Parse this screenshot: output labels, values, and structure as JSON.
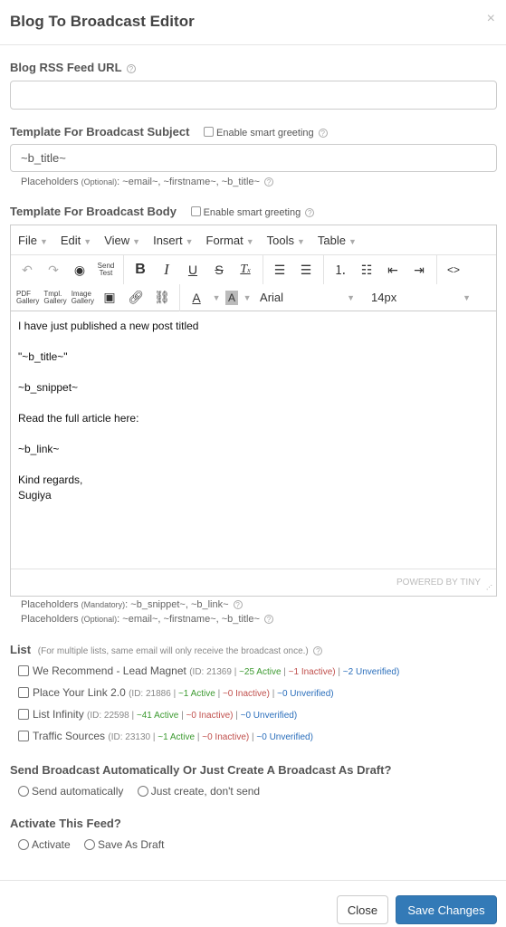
{
  "modal": {
    "title": "Blog To Broadcast Editor",
    "close_icon": "×"
  },
  "rss": {
    "label": "Blog RSS Feed URL",
    "value": "",
    "placeholder": ""
  },
  "subject": {
    "label": "Template For Broadcast Subject",
    "smart_greeting_label": "Enable smart greeting",
    "value": "~b_title~",
    "hint_prefix": "Placeholders",
    "hint_tag": "(Optional)",
    "hint_text": ": ~email~, ~firstname~, ~b_title~"
  },
  "body": {
    "label": "Template For Broadcast Body",
    "smart_greeting_label": "Enable smart greeting",
    "menu": [
      "File",
      "Edit",
      "View",
      "Insert",
      "Format",
      "Tools",
      "Table"
    ],
    "toolbar": {
      "send_test": [
        "Send",
        "Test"
      ],
      "pdf_gallery": [
        "PDF",
        "Gallery"
      ],
      "tmpl_gallery": [
        "Tmpl.",
        "Gallery"
      ],
      "image_gallery": [
        "Image",
        "Gallery"
      ],
      "font_family": "Arial",
      "font_size": "14px"
    },
    "content": [
      "I have just published a new post titled",
      "\"~b_title~\"",
      "~b_snippet~",
      "Read the full article here:",
      "~b_link~",
      "Kind regards,",
      "Sugiya"
    ],
    "powered_by": "POWERED BY TINY",
    "hint_mandatory_prefix": "Placeholders",
    "hint_mandatory_tag": "(Mandatory)",
    "hint_mandatory_text": ": ~b_snippet~, ~b_link~",
    "hint_optional_prefix": "Placeholders",
    "hint_optional_tag": "(Optional)",
    "hint_optional_text": ": ~email~, ~firstname~, ~b_title~"
  },
  "list": {
    "label": "List",
    "note": "(For multiple lists, same email will only receive the broadcast once.)",
    "items": [
      {
        "name": "We Recommend - Lead Magnet",
        "id": "(ID: 21369 | ",
        "active": "~25 Active",
        "inactive": "~1 Inactive)",
        "unverified": "~2 Unverified)"
      },
      {
        "name": "Place Your Link 2.0",
        "id": "(ID: 21886 | ",
        "active": "~1 Active",
        "inactive": "~0 Inactive)",
        "unverified": "~0 Unverified)"
      },
      {
        "name": "List Infinity",
        "id": "(ID: 22598 | ",
        "active": "~41 Active",
        "inactive": "~0 Inactive)",
        "unverified": "~0 Unverified)"
      },
      {
        "name": "Traffic Sources",
        "id": "(ID: 23130 | ",
        "active": "~1 Active",
        "inactive": "~0 Inactive)",
        "unverified": "~0 Unverified)"
      }
    ]
  },
  "send_mode": {
    "label": "Send Broadcast Automatically Or Just Create A Broadcast As Draft?",
    "options": [
      "Send automatically",
      "Just create, don't send"
    ]
  },
  "activate": {
    "label": "Activate This Feed?",
    "options": [
      "Activate",
      "Save As Draft"
    ]
  },
  "footer": {
    "close_label": "Close",
    "save_label": "Save Changes"
  },
  "colors": {
    "primary": "#337ab7",
    "active": "#3c9a30",
    "inactive": "#c0504d",
    "unverified": "#2a6ebb"
  }
}
